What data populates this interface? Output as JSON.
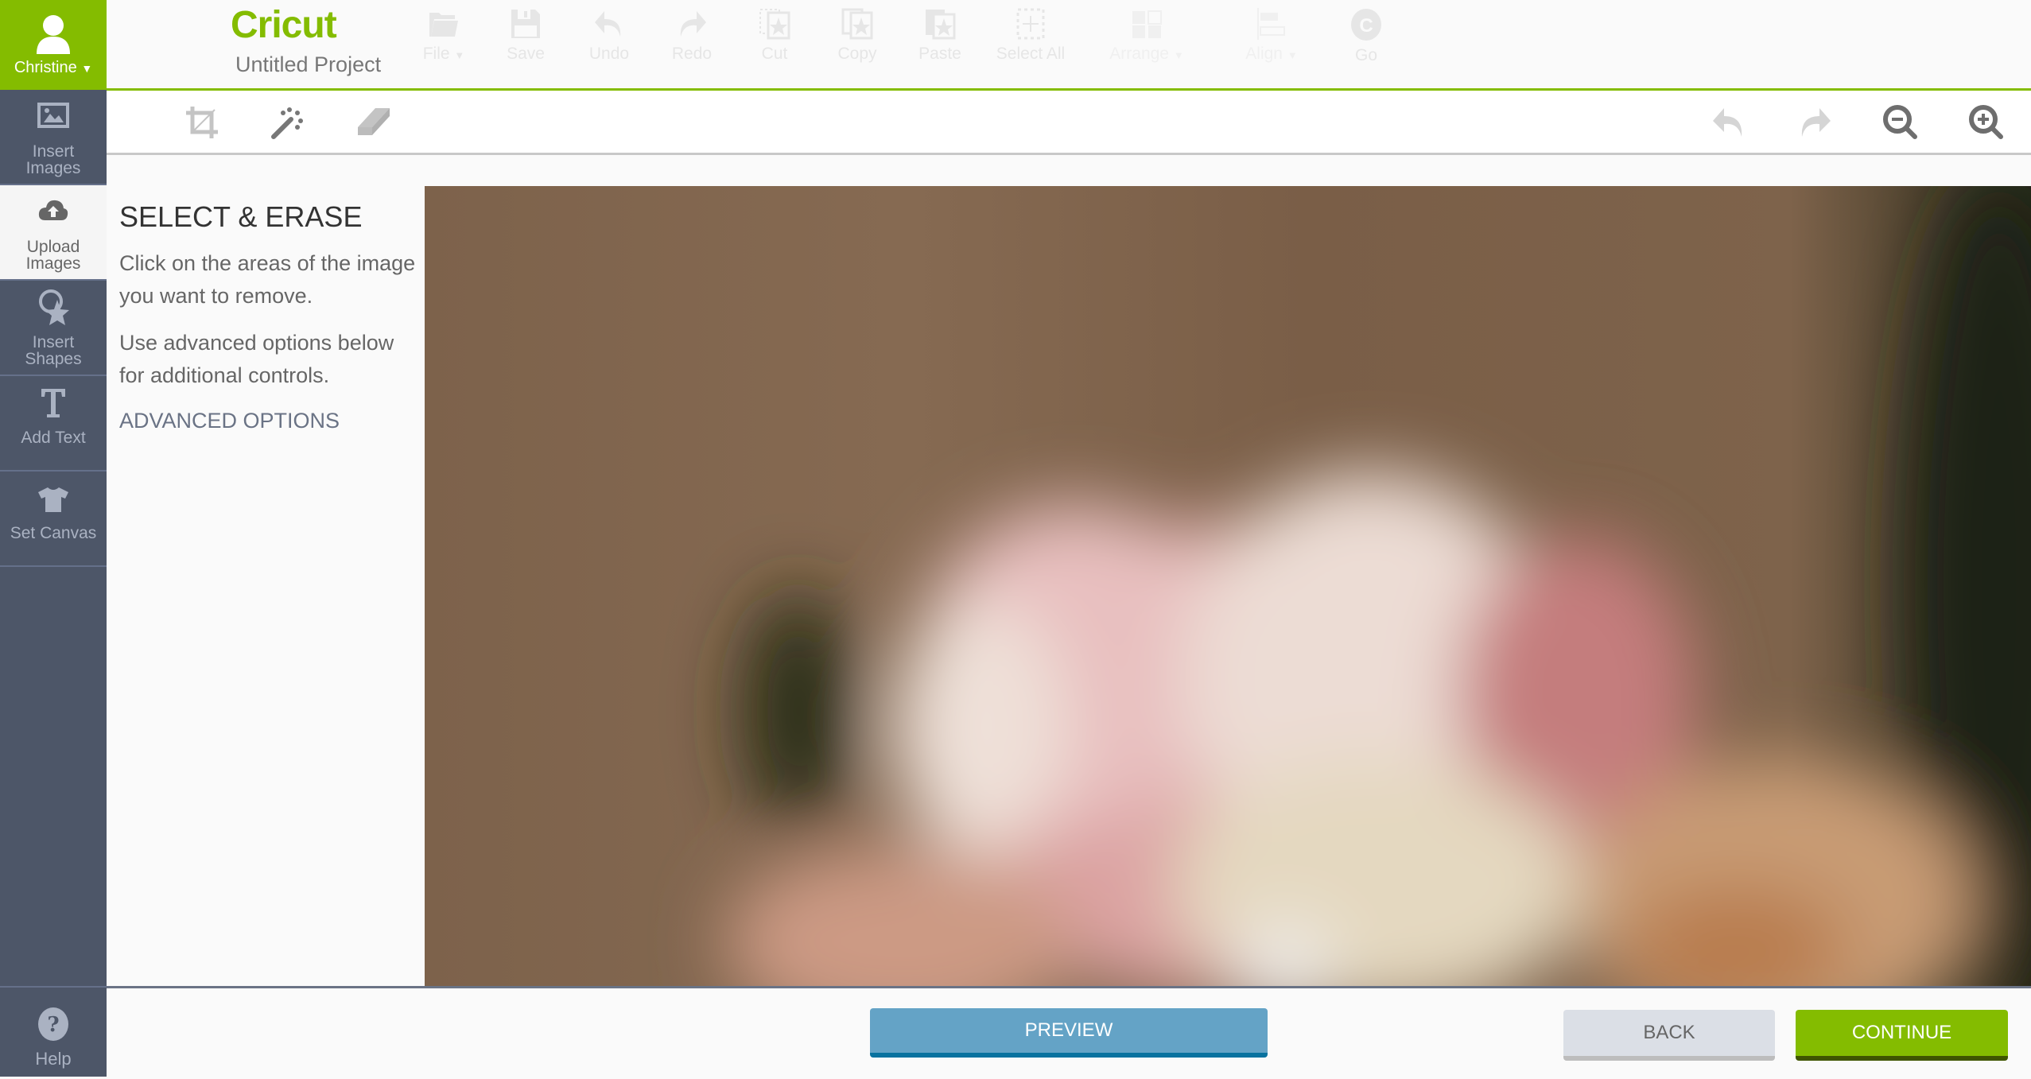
{
  "app": {
    "brand": "Cricut",
    "project_title": "Untitled Project"
  },
  "user": {
    "name": "Christine"
  },
  "sidebar": {
    "items": [
      {
        "label_line1": "Insert",
        "label_line2": "Images",
        "icon": "image-icon",
        "active": false
      },
      {
        "label_line1": "Upload",
        "label_line2": "Images",
        "icon": "cloud-upload-icon",
        "active": true
      },
      {
        "label_line1": "Insert",
        "label_line2": "Shapes",
        "icon": "shapes-icon",
        "active": false
      },
      {
        "label_line1": "Add Text",
        "label_line2": "",
        "icon": "text-icon",
        "active": false
      },
      {
        "label_line1": "Set Canvas",
        "label_line2": "",
        "icon": "tshirt-icon",
        "active": false
      }
    ],
    "help": {
      "label": "Help",
      "icon": "help-icon"
    }
  },
  "header": {
    "buttons": [
      {
        "label": "File",
        "icon": "folder-icon",
        "dropdown": true
      },
      {
        "label": "Save",
        "icon": "save-icon"
      },
      {
        "label": "Undo",
        "icon": "undo-icon"
      },
      {
        "label": "Redo",
        "icon": "redo-icon"
      },
      {
        "label": "Cut",
        "icon": "cut-icon"
      },
      {
        "label": "Copy",
        "icon": "copy-icon"
      },
      {
        "label": "Paste",
        "icon": "paste-icon"
      },
      {
        "label": "Select All",
        "icon": "select-all-icon"
      },
      {
        "label": "Arrange",
        "icon": "arrange-icon",
        "dropdown": true
      },
      {
        "label": "Align",
        "icon": "align-icon",
        "dropdown": true
      },
      {
        "label": "Go",
        "icon": "go-icon"
      }
    ]
  },
  "toolbar": {
    "left_tools": [
      "crop-icon",
      "magic-wand-icon",
      "eraser-icon"
    ],
    "right_tools": [
      "undo-icon",
      "redo-icon",
      "zoom-out-icon",
      "zoom-in-icon"
    ]
  },
  "panel": {
    "title": "SELECT & ERASE",
    "paragraph1": "Click on the areas of the image you want to remove.",
    "paragraph2": "Use advanced options below for additional controls.",
    "advanced_link": "ADVANCED OPTIONS"
  },
  "footer": {
    "preview_label": "PREVIEW",
    "back_label": "BACK",
    "continue_label": "CONTINUE"
  },
  "colors": {
    "brand_green": "#84bc00",
    "sidebar_bg": "#4d5668",
    "preview_blue": "#64a3c6",
    "back_grey": "#dbdfe6"
  }
}
